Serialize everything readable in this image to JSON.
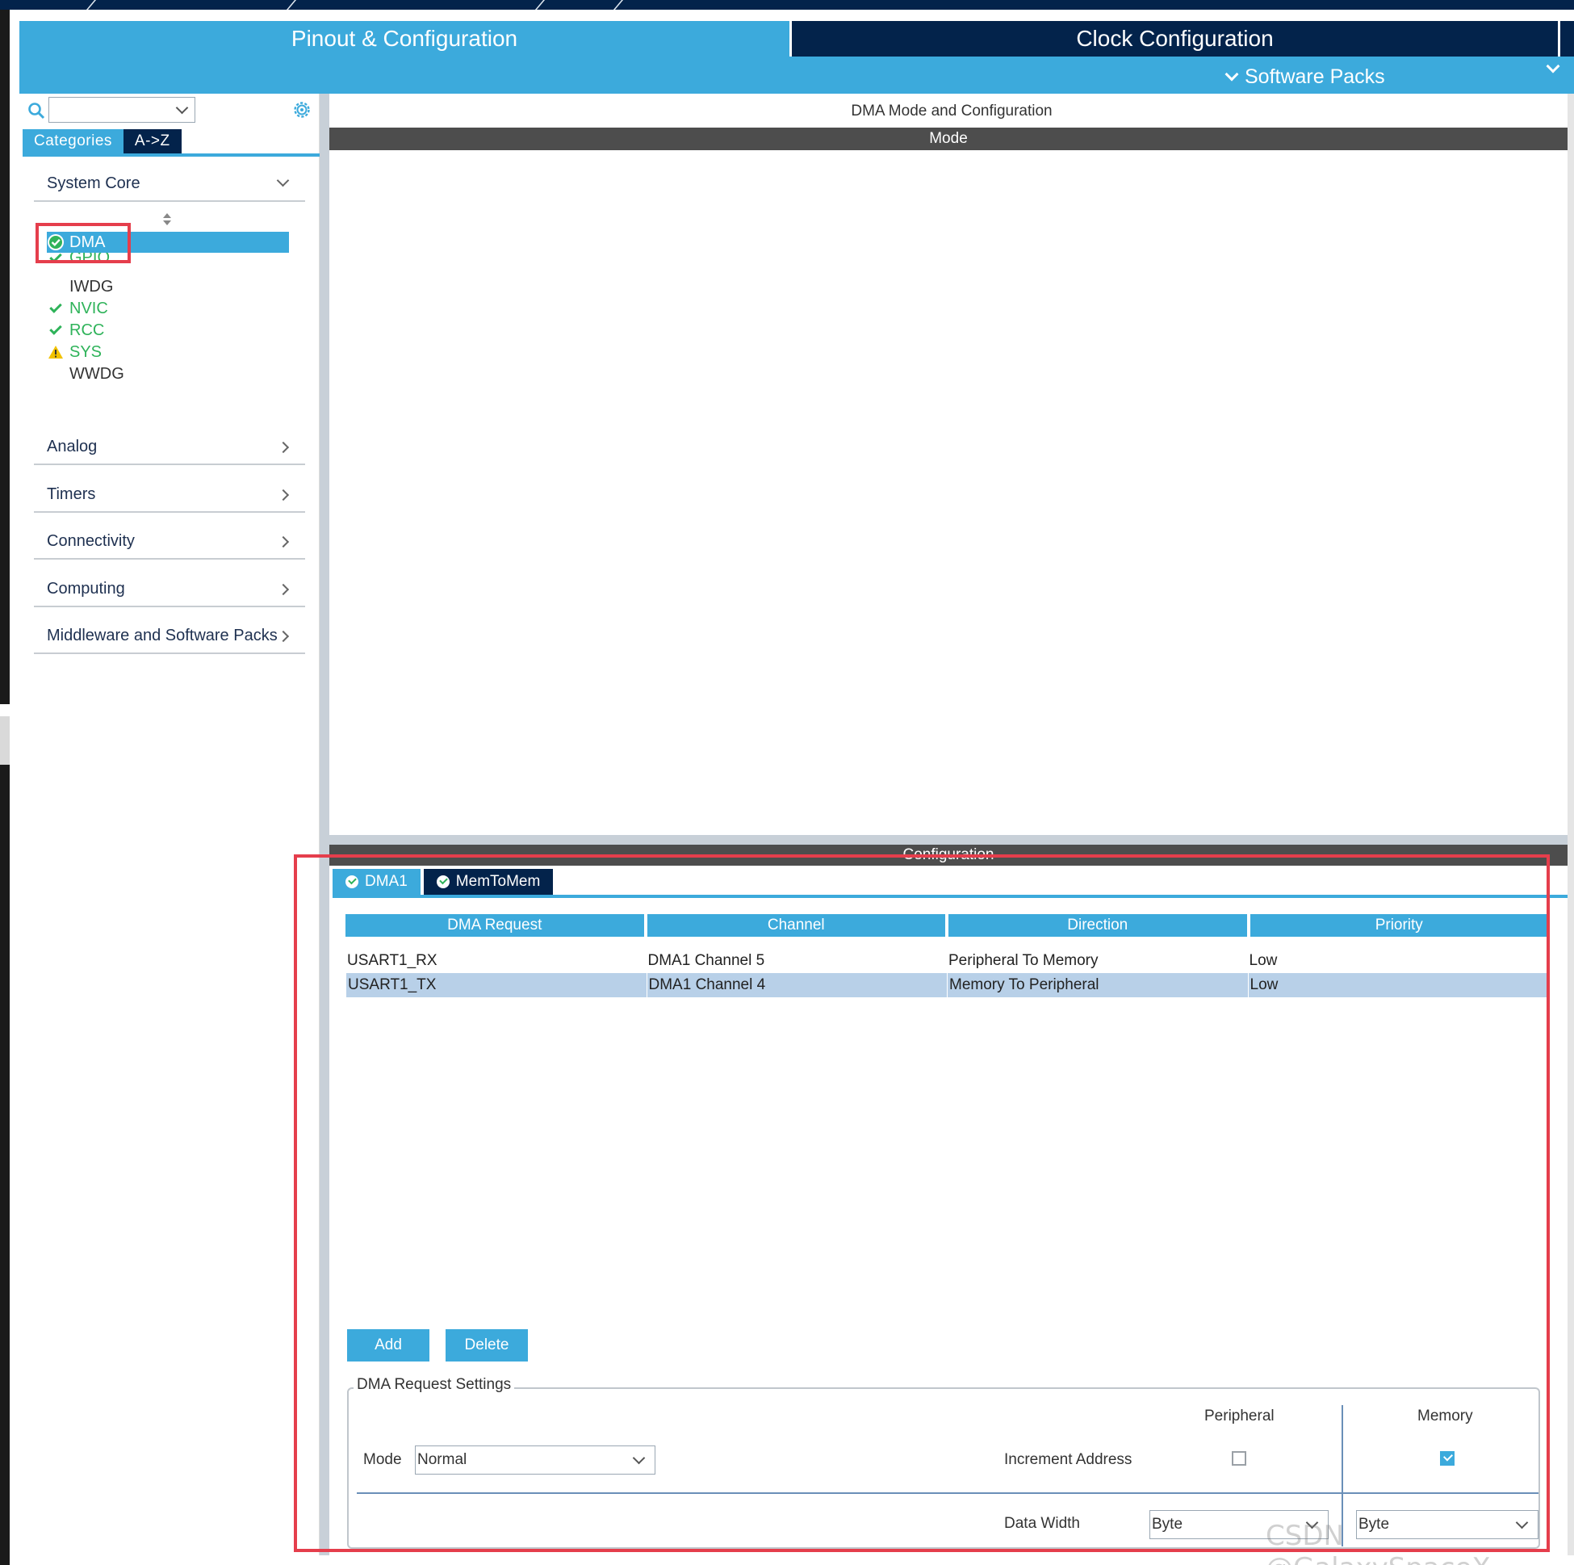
{
  "header": {
    "tab_pinout": "Pinout & Configuration",
    "tab_clock": "Clock Configuration",
    "software_packs": "Software Packs"
  },
  "sidebar": {
    "search_placeholder": "",
    "tabs": {
      "categories": "Categories",
      "az": "A->Z"
    },
    "sections": {
      "system_core": "System Core",
      "analog": "Analog",
      "timers": "Timers",
      "connectivity": "Connectivity",
      "computing": "Computing",
      "middleware": "Middleware and Software Packs"
    },
    "peripherals": [
      {
        "label": "DMA",
        "status": "enabled-selected"
      },
      {
        "label": "GPIO",
        "status": "enabled"
      },
      {
        "label": "IWDG",
        "status": "none"
      },
      {
        "label": "NVIC",
        "status": "enabled"
      },
      {
        "label": "RCC",
        "status": "enabled"
      },
      {
        "label": "SYS",
        "status": "warning"
      },
      {
        "label": "WWDG",
        "status": "none"
      }
    ]
  },
  "main": {
    "title": "DMA Mode and Configuration",
    "mode_bar": "Mode",
    "config_bar": "Configuration",
    "config_tabs": [
      "DMA1",
      "MemToMem"
    ],
    "table": {
      "headers": [
        "DMA Request",
        "Channel",
        "Direction",
        "Priority"
      ],
      "rows": [
        [
          "USART1_RX",
          "DMA1 Channel 5",
          "Peripheral To Memory",
          "Low"
        ],
        [
          "USART1_TX",
          "DMA1 Channel 4",
          "Memory To Peripheral",
          "Low"
        ]
      ]
    },
    "buttons": {
      "add": "Add",
      "delete": "Delete"
    },
    "settings": {
      "legend": "DMA Request Settings",
      "peripheral_col": "Peripheral",
      "memory_col": "Memory",
      "mode_label": "Mode",
      "mode_value": "Normal",
      "increment_label": "Increment Address",
      "peripheral_increment": false,
      "memory_increment": true,
      "data_width_label": "Data Width",
      "peripheral_width": "Byte",
      "memory_width": "Byte"
    }
  },
  "watermark": "CSDN @GalaxySpaceX",
  "colors": {
    "accent": "#3caadc",
    "navy": "#03234b",
    "status_green": "#2fb35a",
    "warning": "#f2c200",
    "highlight": "#e53e4c"
  }
}
